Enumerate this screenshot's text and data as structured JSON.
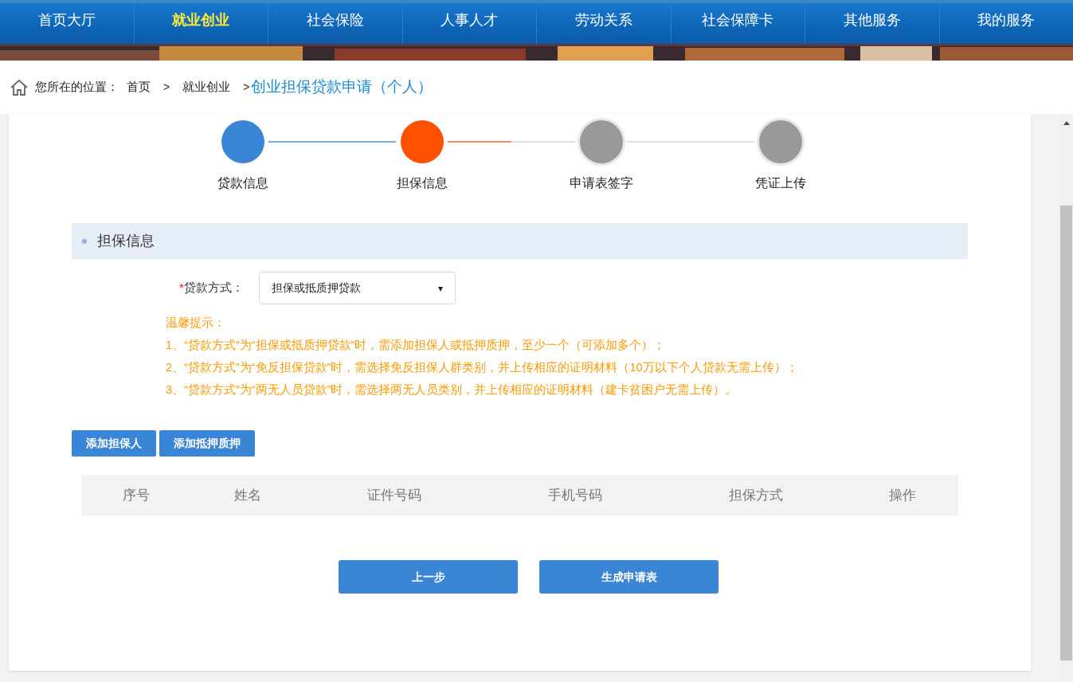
{
  "nav": [
    {
      "label": "首页大厅",
      "selected": false
    },
    {
      "label": "就业创业",
      "selected": true
    },
    {
      "label": "社会保险",
      "selected": false
    },
    {
      "label": "人事人才",
      "selected": false
    },
    {
      "label": "劳动关系",
      "selected": false
    },
    {
      "label": "社会保障卡",
      "selected": false
    },
    {
      "label": "其他服务",
      "selected": false
    },
    {
      "label": "我的服务",
      "selected": false
    }
  ],
  "breadcrumb": {
    "prefix": "您所在的位置：",
    "items": [
      "首页",
      "就业创业"
    ],
    "separators": [
      ">",
      ">"
    ],
    "current": "创业担保贷款申请（个人）"
  },
  "steps": [
    {
      "label": "贷款信息",
      "done": true,
      "selected": false
    },
    {
      "label": "担保信息",
      "done": false,
      "selected": true
    },
    {
      "label": "申请表签字",
      "done": false,
      "selected": false
    },
    {
      "label": "凭证上传",
      "done": false,
      "selected": false
    }
  ],
  "section": {
    "title": "担保信息"
  },
  "loan_field": {
    "required_mark": "*",
    "label": "贷款方式：",
    "value": "担保或抵质押贷款",
    "arrow": "▾"
  },
  "tips": [
    "温馨提示：",
    "1、“贷款方式”为“担保或抵质押贷款”时，需添加担保人或抵押质押，至少一个（可添加多个）；",
    "2、“贷款方式”为“免反担保贷款”时，需选择免反担保人群类别，并上传相应的证明材料（10万以下个人贷款无需上传）；",
    "3、“贷款方式”为“两无人员贷款”时，需选择两无人员类别，并上传相应的证明材料（建卡贫困户无需上传）。"
  ],
  "add_buttons": [
    "添加担保人",
    "添加抵押质押"
  ],
  "table": {
    "columns": [
      "序号",
      "姓名",
      "证件号码",
      "手机号码",
      "担保方式",
      "操作"
    ]
  },
  "footer_buttons": [
    "上一步",
    "生成申请表"
  ]
}
